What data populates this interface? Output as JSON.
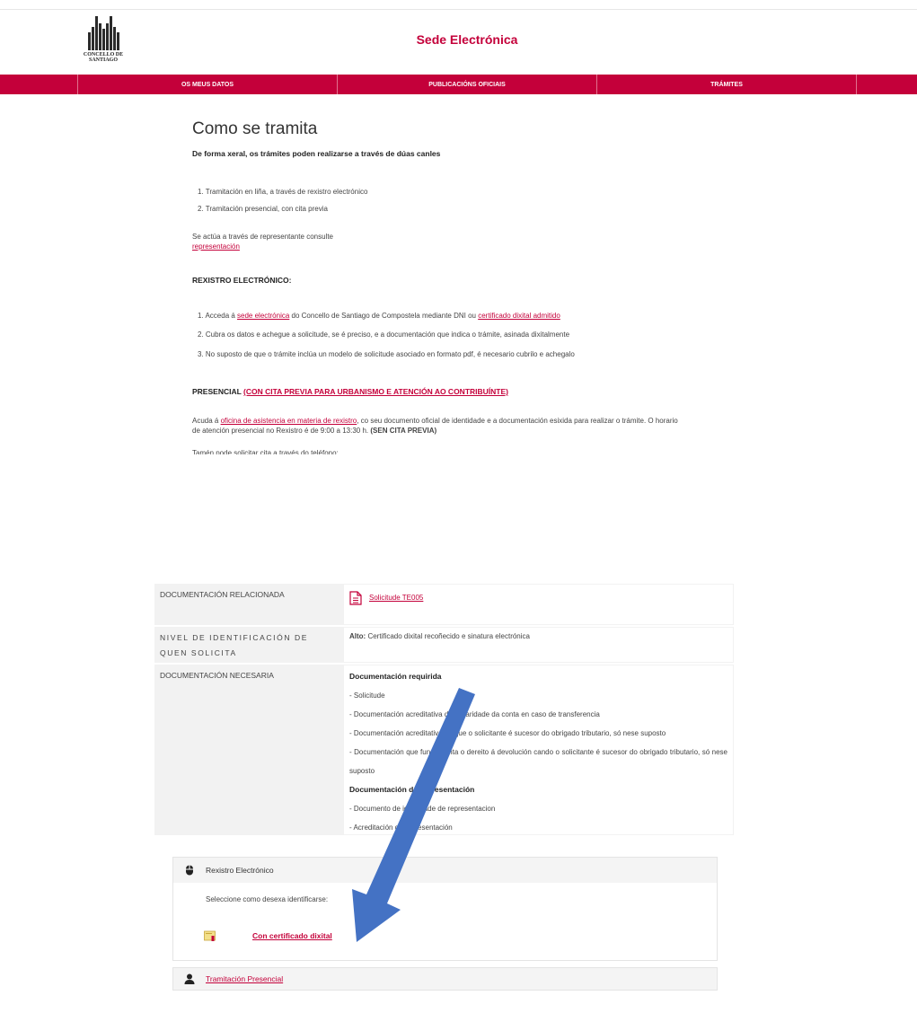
{
  "header": {
    "logo_text": "CONCELLO DE SANTIAGO",
    "site_title": "Sede Electrónica"
  },
  "nav": {
    "items": [
      "OS MEUS DATOS",
      "PUBLICACIÓNS OFICIAIS",
      "TRÁMITES"
    ]
  },
  "main": {
    "heading": "Como se tramita",
    "intro": "De forma xeral, os trámites poden realizarse a través de dúas canles",
    "channels": [
      "1. Tramitación en liña, a través de rexistro electrónico",
      "2. Tramitación presencial, con cita previa"
    ],
    "rep_text": "Se actúa a través de representante consulte",
    "rep_link": "representación",
    "rexistro_heading": "REXISTRO ELECTRÓNICO:",
    "step1_a": "1. Acceda á ",
    "step1_link1": "sede electrónica",
    "step1_b": " do Concello de Santiago de Compostela mediante DNI ou ",
    "step1_link2": "certificado dixital admitido",
    "step2": "2. Cubra os datos e achegue a solicitude, se é preciso, e a documentación que indica o trámite, asinada dixitalmente",
    "step3": "3. No suposto de que o trámite inclúa un modelo de solicitude asociado en formato pdf, é necesario cubrilo e achegalo",
    "presencial_label": "PRESENCIAL ",
    "presencial_link": "(CON CITA PREVIA PARA URBANISMO E ATENCIÓN AO CONTRIBUÍNTE)",
    "acuda_a": "Acuda á ",
    "acuda_link": "oficina de asistencia en materia de rexistro",
    "acuda_b": ", co seu documento oficial de identidade e a documentación esixida para realizar o trámite. O horario",
    "acuda_c": "de atención presencial no Rexistro é de 9:00 a 13:30 h. ",
    "acuda_bold": "(SEN CITA PREVIA)",
    "tamen": "Tamén pode solicitar cita a través do teléfono:"
  },
  "table": {
    "row1_label": "DOCUMENTACIÓN RELACIONADA",
    "row1_link": "Solicitude TE005",
    "row2_label": "NIVEL DE IDENTIFICACIÓN DE QUEN SOLICITA",
    "row2_bold": "Alto:",
    "row2_text": " Certificado dixital recoñecido e sinatura electrónica",
    "row3_label": "DOCUMENTACIÓN NECESARIA",
    "req_title": "Documentación requirida",
    "req_items": [
      "- Solicitude",
      "- Documentación acreditativa da titularidade da conta en caso de transferencia",
      "- Documentación acreditativa de que o solicitante é sucesor do obrigado tributario, só nese suposto",
      "- Documentación que fundamenta o dereito á devolución cando o solicitante é sucesor do obrigado tributario, só nese suposto"
    ],
    "rep_title": "Documentación de representación",
    "rep_items": [
      "- Documento de identidade de representacion",
      "- Acreditación da representación"
    ]
  },
  "panel_electronic": {
    "title": "Rexistro Electrónico",
    "prompt": "Seleccione como desexa identificarse:",
    "cert_link": "Con certificado dixital"
  },
  "panel_presencial": {
    "link": "Tramitación Presencial"
  },
  "colors": {
    "brand": "#c4003a",
    "arrow": "#4472c4"
  }
}
